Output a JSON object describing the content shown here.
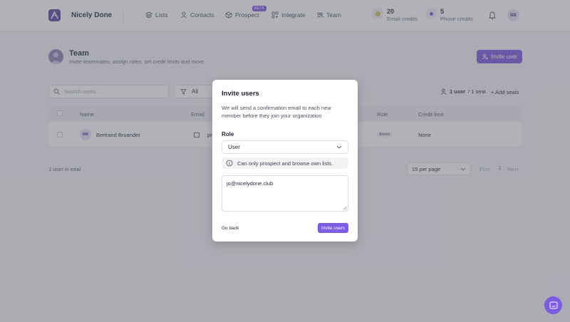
{
  "header": {
    "brand": "Nicely Done",
    "nav": [
      {
        "label": "Lists",
        "icon": "layers-icon"
      },
      {
        "label": "Contacts",
        "icon": "person-icon"
      },
      {
        "label": "Prospect",
        "icon": "cube-icon",
        "badge": "BETA"
      },
      {
        "label": "Integrate",
        "icon": "grid-plus-icon"
      },
      {
        "label": "Team",
        "icon": "team-icon"
      }
    ],
    "credits": [
      {
        "value": "20",
        "label": "Email credits"
      },
      {
        "value": "5",
        "label": "Phone credits"
      }
    ],
    "user_initials": "BB"
  },
  "page": {
    "title": "Team",
    "subtitle": "Invite teammates, assign roles, set credit limits and more.",
    "invite_button": "Invite user",
    "search_placeholder": "Search users...",
    "filter_label": "All",
    "user_count_bold": "1 user",
    "user_count_rest": "/ 1 seat",
    "add_seats": "+ Add seats",
    "columns": [
      "Name",
      "Email",
      "Role",
      "Credit limit"
    ],
    "rows": [
      {
        "initials": "BB",
        "name": "Bertrand Bruandet",
        "email": "pr",
        "role": "Admin",
        "credit_limit": "None"
      }
    ],
    "total": "1 user in total",
    "per_page": "15 per page",
    "first": "First",
    "page_number": "1",
    "next": "Next"
  },
  "modal": {
    "title": "Invite users",
    "description": "We will send a confirmation email to each new member before they join your organization",
    "role_label": "Role",
    "role_value": "User",
    "role_info": "Can only prospect and browse own lists.",
    "emails": "jo@nicelydone.club",
    "back_button": "Go back",
    "invite_button": "Invite users"
  },
  "colors": {
    "accent": "#7c5ce0",
    "overlay": "#565864"
  }
}
